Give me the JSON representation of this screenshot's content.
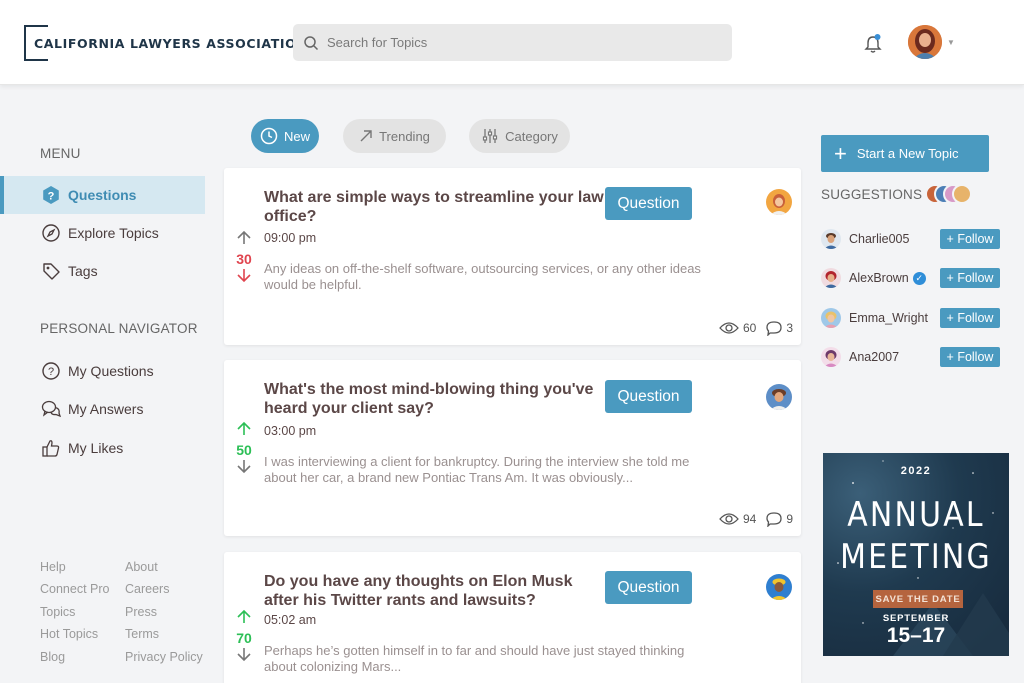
{
  "header": {
    "logo": "CALIFORNIA LAWYERS ASSOCIATION",
    "search_placeholder": "Search for Topics"
  },
  "sidebar": {
    "menu_heading": "MENU",
    "menu_items": [
      {
        "label": "Questions",
        "icon": "question-circle-icon",
        "active": true
      },
      {
        "label": "Explore Topics",
        "icon": "compass-icon"
      },
      {
        "label": "Tags",
        "icon": "tag-icon"
      }
    ],
    "personal_heading": "PERSONAL NAVIGATOR",
    "personal_items": [
      {
        "label": "My Questions",
        "icon": "question-icon"
      },
      {
        "label": "My Answers",
        "icon": "chat-icon"
      },
      {
        "label": "My Likes",
        "icon": "thumbs-up-icon"
      }
    ],
    "footer_links": [
      "Help",
      "About",
      "Connect Pro",
      "Careers",
      "Topics",
      "Press",
      "Hot Topics",
      "Terms",
      "Blog",
      "Privacy Policy"
    ]
  },
  "filters": [
    {
      "label": "New",
      "icon": "clock-icon",
      "active": true
    },
    {
      "label": "Trending",
      "icon": "trending-arrow-icon"
    },
    {
      "label": "Category",
      "icon": "sliders-icon"
    }
  ],
  "posts": [
    {
      "title": "What are simple ways to streamline your law office?",
      "time": "09:00 pm",
      "excerpt": "Any ideas on off-the-shelf software, outsourcing services, or any other ideas would be helpful.",
      "badge": "Question",
      "votes": "30",
      "vote_color": "#e0454f",
      "views": "60",
      "comments": "3"
    },
    {
      "title": "What's the most mind-blowing thing you've heard your client say?",
      "time": "03:00 pm",
      "excerpt": "I was interviewing a client for bankruptcy. During the interview she told me about her car, a brand new Pontiac Trans Am. It was obviously...",
      "badge": "Question",
      "votes": "50",
      "vote_color": "#2cbf56",
      "views": "94",
      "comments": "9"
    },
    {
      "title": "Do you have any thoughts on Elon Musk after his Twitter rants and lawsuits?",
      "time": "05:02 am",
      "excerpt": "Perhaps he’s gotten himself in to far and should have just stayed thinking about colonizing Mars...",
      "badge": "Question",
      "votes": "70",
      "vote_color": "#2cbf56"
    }
  ],
  "right": {
    "start_topic": "Start a New Topic",
    "suggestions_heading": "SUGGESTIONS",
    "users": [
      {
        "name": "Charlie005",
        "verified": false
      },
      {
        "name": "AlexBrown",
        "verified": true
      },
      {
        "name": "Emma_Wright",
        "verified": false
      },
      {
        "name": "Ana2007",
        "verified": false
      }
    ],
    "follow_label": "+ Follow",
    "ad": {
      "year": "2022",
      "line1": "ANNUAL",
      "line2": "MEETING",
      "cta": "SAVE THE DATE",
      "month": "SEPTEMBER",
      "dates": "15–17"
    }
  },
  "colors": {
    "accent": "#4a9ac0",
    "downvote": "#e0454f",
    "upvote": "#2cbf56"
  }
}
